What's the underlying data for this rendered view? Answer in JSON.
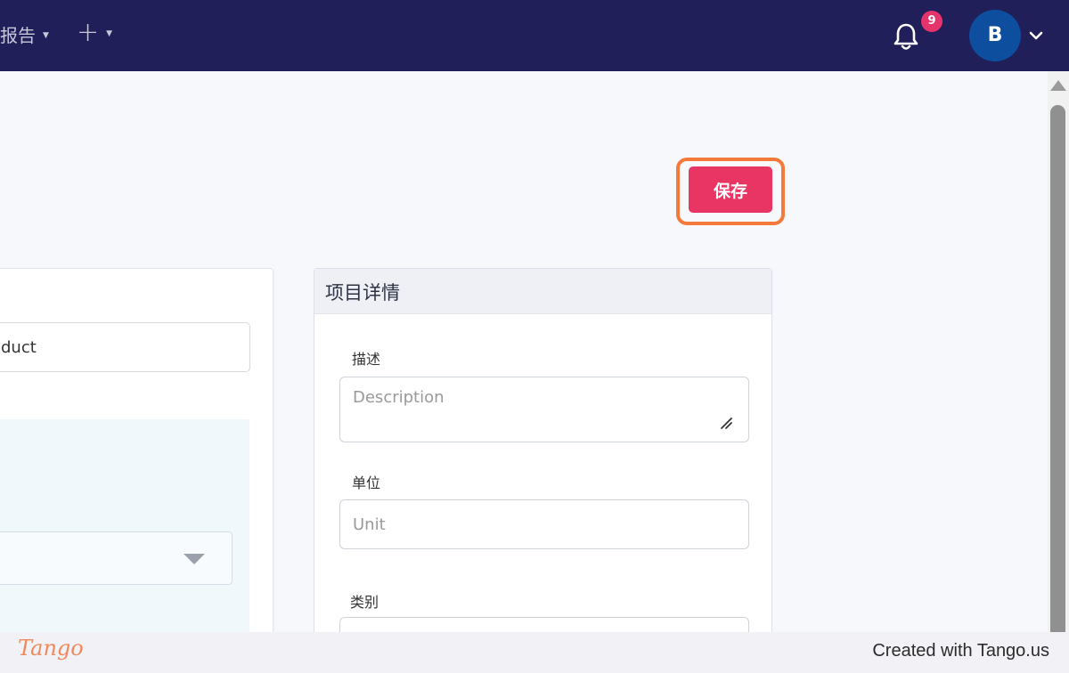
{
  "topbar": {
    "nav_reports_label": "报告",
    "nav_add_label": "+",
    "notification_count": "9",
    "avatar_initial": "B"
  },
  "toolbar": {
    "save_label": "保存"
  },
  "left_card": {
    "name_value": "duct"
  },
  "project_details": {
    "title": "项目详情",
    "description_label": "描述",
    "description_placeholder": "Description",
    "unit_label": "单位",
    "unit_placeholder": "Unit",
    "category_label": "类别"
  },
  "footer": {
    "logo": "Tango",
    "created_with": "Created with Tango.us"
  },
  "colors": {
    "topbar": "#201f5a",
    "save_button": "#e93563",
    "highlight": "#f37a3b",
    "badge": "#e5336b",
    "avatar": "#0d4f9e"
  }
}
